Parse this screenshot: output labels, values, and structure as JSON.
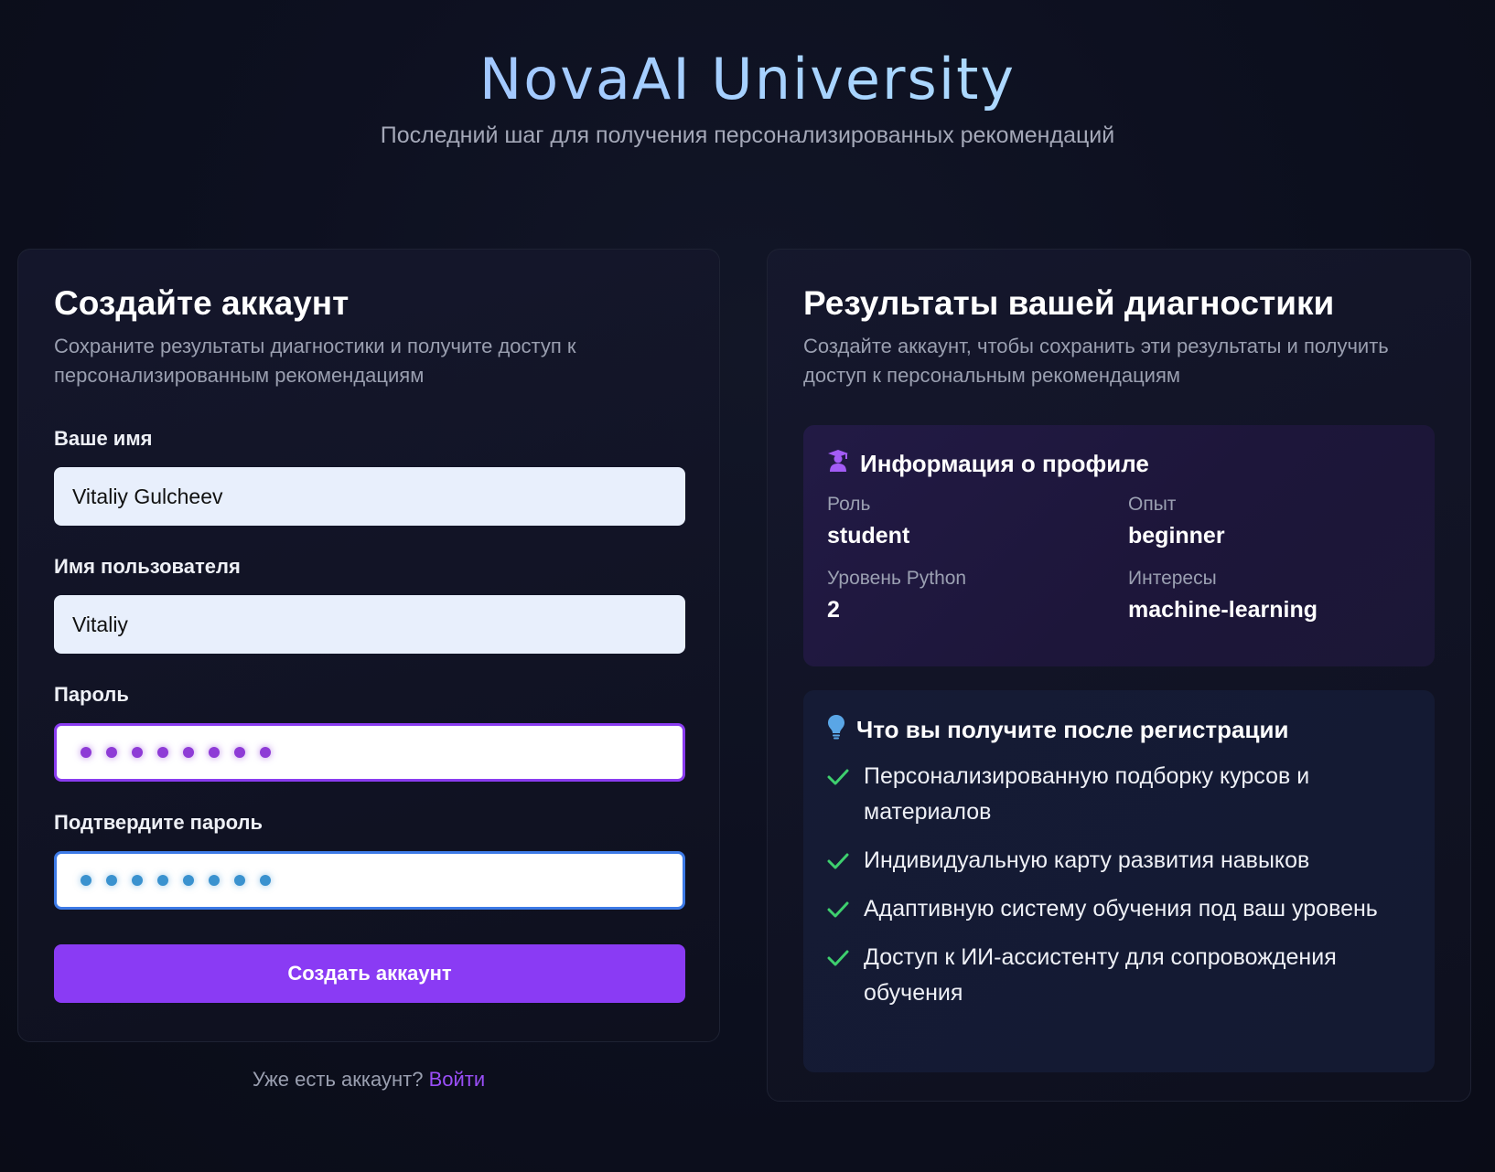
{
  "header": {
    "brand": "NovaAI University",
    "tagline": "Последний шаг для получения персонализированных рекомендаций"
  },
  "signup": {
    "title": "Создайте аккаунт",
    "subtitle": "Сохраните результаты диагностики и получите доступ к персонализированным рекомендациям",
    "fields": {
      "name": {
        "label": "Ваше имя",
        "value": "Vitaliy Gulcheev"
      },
      "username": {
        "label": "Имя пользователя",
        "value": "Vitaliy"
      },
      "password": {
        "label": "Пароль"
      },
      "confirm": {
        "label": "Подтвердите пароль"
      }
    },
    "submit_label": "Создать аккаунт",
    "login_prompt": "Уже есть аккаунт?",
    "login_link": "Войти"
  },
  "results": {
    "title": "Результаты вашей диагностики",
    "subtitle": "Создайте аккаунт, чтобы сохранить эти результаты и получить доступ к персональным рекомендациям",
    "profile": {
      "heading": "Информация о профиле",
      "icon": "graduate-icon",
      "stats": [
        {
          "label": "Роль",
          "value": "student"
        },
        {
          "label": "Опыт",
          "value": "beginner"
        },
        {
          "label": "Уровень Python",
          "value": "2"
        },
        {
          "label": "Интересы",
          "value": "machine-learning"
        }
      ]
    },
    "benefits": {
      "heading": "Что вы получите после регистрации",
      "icon": "lightbulb-icon",
      "items": [
        "Персонализированную подборку курсов и материалов",
        "Индивидуальную карту развития навыков",
        "Адаптивную систему обучения под ваш уровень",
        "Доступ к ИИ-ассистенту для сопровождения обучения"
      ]
    }
  },
  "colors": {
    "accent": "#8a3bf4",
    "check": "#3ecf6e",
    "background": "#0d1020"
  }
}
